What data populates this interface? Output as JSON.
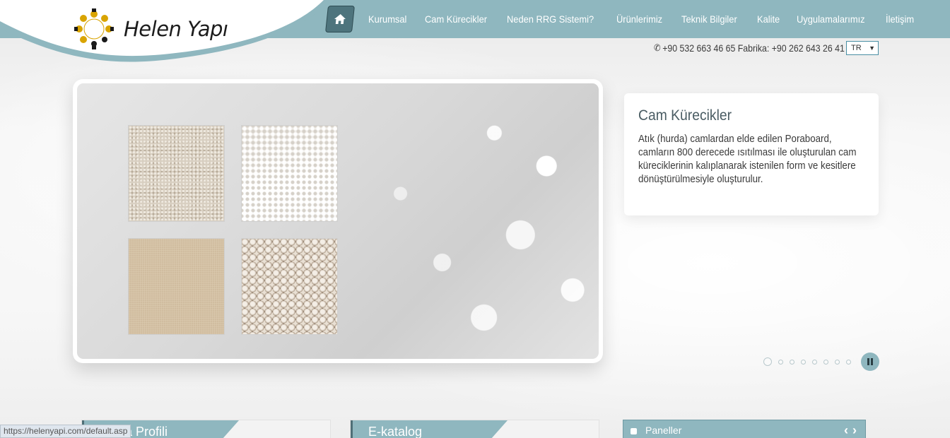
{
  "header": {
    "logo_text": "Helen Yapı",
    "home_icon": "home-icon",
    "nav": [
      "Kurumsal",
      "Cam Kürecikler",
      "Neden RRG Sistemi?",
      "Ürünlerimiz",
      "Teknik Bilgiler",
      "Kalite",
      "Uygulamalarımız",
      "İletişim"
    ],
    "contact_text": "+90 532 663 46 65 Fabrika: +90 262 643 26 41",
    "lang_selected": "TR",
    "accent_color": "#8fb7bf"
  },
  "slider": {
    "caption_title": "Cam Kürecikler",
    "caption_text": "Atık (hurda) camlardan elde edilen Poraboard, camların 800 derecede ısıtılması ile oluşturulan cam küreciklerinin kalıplanarak istenilen form ve kesitlere dönüştürülmesiyle oluşturulur.",
    "slide_count": 8,
    "active_index": 0
  },
  "panels": {
    "firma_profili": "Firma Profili",
    "e_katalog": "E-katalog",
    "paneller": "Paneller"
  },
  "status_url": "https://helenyapi.com/default.asp"
}
